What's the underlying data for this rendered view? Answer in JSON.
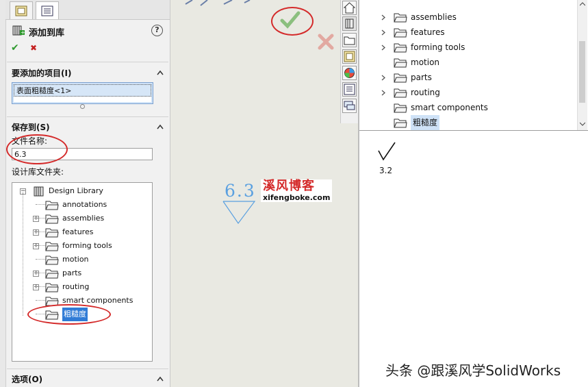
{
  "property_manager": {
    "title": "添加到库",
    "ok_glyph": "✔",
    "cancel_glyph": "✖",
    "help_glyph": "?",
    "items_section": {
      "title": "要添加的项目(I)",
      "item": "表面粗糙度<1>"
    },
    "save_section": {
      "title": "保存到(S)",
      "filename_label": "文件名称:",
      "filename_value": "6.3",
      "folder_label": "设计库文件夹:"
    },
    "tree": {
      "root": "Design Library",
      "items": [
        {
          "label": "annotations",
          "expandable": false
        },
        {
          "label": "assemblies",
          "expandable": true
        },
        {
          "label": "features",
          "expandable": true
        },
        {
          "label": "forming tools",
          "expandable": true
        },
        {
          "label": "motion",
          "expandable": false
        },
        {
          "label": "parts",
          "expandable": true
        },
        {
          "label": "routing",
          "expandable": true
        },
        {
          "label": "smart components",
          "expandable": false
        },
        {
          "label": "粗糙度",
          "expandable": false,
          "selected": true
        }
      ]
    },
    "options_section": {
      "title": "选项(O)"
    }
  },
  "canvas": {
    "symbol_value": "6.3",
    "watermark_cn": "溪风博客",
    "watermark_url": "xifengboke.com"
  },
  "right_panel": {
    "items": [
      {
        "label": "assemblies",
        "expandable": true
      },
      {
        "label": "features",
        "expandable": true
      },
      {
        "label": "forming tools",
        "expandable": true
      },
      {
        "label": "motion",
        "expandable": false
      },
      {
        "label": "parts",
        "expandable": true
      },
      {
        "label": "routing",
        "expandable": true
      },
      {
        "label": "smart components",
        "expandable": false
      },
      {
        "label": "粗糙度",
        "expandable": false,
        "selected": true
      }
    ],
    "preview_value": "3.2"
  },
  "footer_watermark": "头条 @跟溪风学SolidWorks",
  "colors": {
    "accent": "#2f7bd6",
    "annotation_red": "#d42a2a",
    "ok_green": "#2f9a2f",
    "symbol_blue": "#5aa0e0"
  }
}
